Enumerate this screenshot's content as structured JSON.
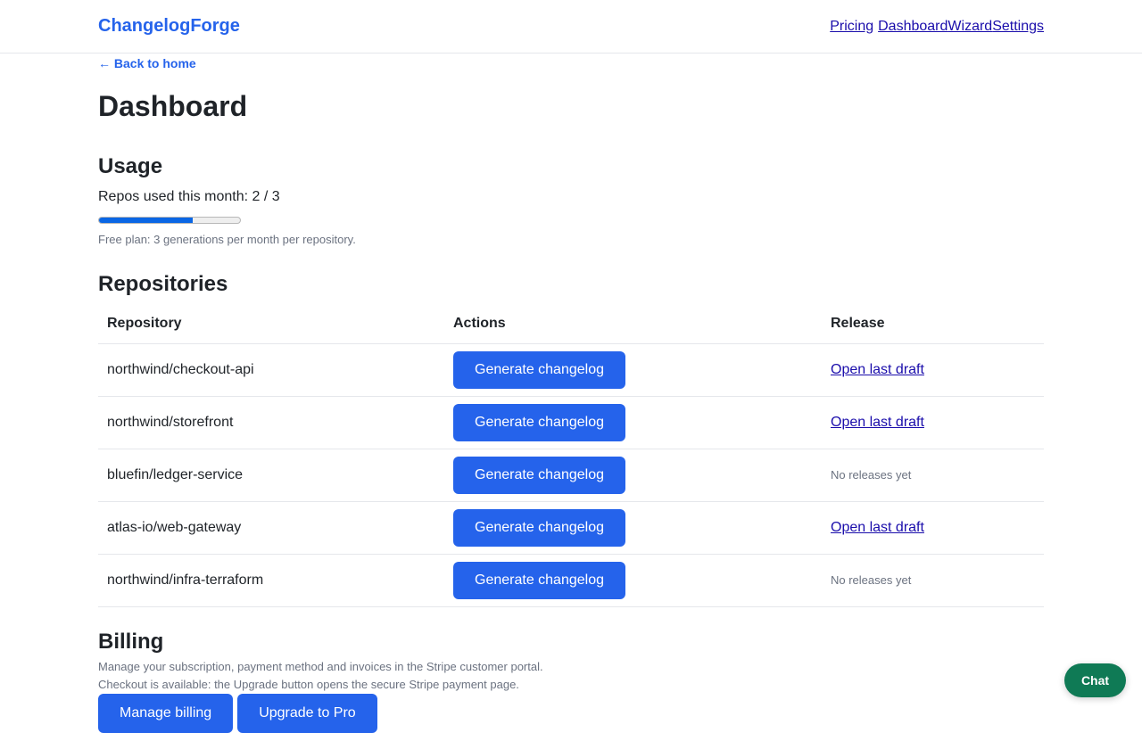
{
  "header": {
    "brand": "ChangelogForge",
    "nav": [
      "Pricing",
      "Dashboard",
      "Wizard",
      "Settings"
    ]
  },
  "back_link": "← Back to home",
  "page_title": "Dashboard",
  "usage": {
    "heading": "Usage",
    "text": "Repos used this month: 2 / 3",
    "progress_fraction": 0.6667,
    "note": "Free plan: 3 generations per month per repository."
  },
  "repositories": {
    "heading": "Repositories",
    "columns": [
      "Repository",
      "Actions",
      "Release"
    ],
    "rows": [
      {
        "repo": "northwind/checkout-api",
        "action": "Generate changelog",
        "release": "Open last draft",
        "has_release": true
      },
      {
        "repo": "northwind/storefront",
        "action": "Generate changelog",
        "release": "Open last draft",
        "has_release": true
      },
      {
        "repo": "bluefin/ledger-service",
        "action": "Generate changelog",
        "release": "No releases yet",
        "has_release": false
      },
      {
        "repo": "atlas-io/web-gateway",
        "action": "Generate changelog",
        "release": "Open last draft",
        "has_release": true
      },
      {
        "repo": "northwind/infra-terraform",
        "action": "Generate changelog",
        "release": "No releases yet",
        "has_release": false
      }
    ]
  },
  "billing": {
    "heading": "Billing",
    "line1": "Manage your subscription, payment method and invoices in the Stripe customer portal.",
    "line2": "Checkout is available: the Upgrade button opens the secure Stripe payment page.",
    "manage_label": "Manage billing",
    "upgrade_label": "Upgrade to Pro"
  },
  "chat_label": "Chat",
  "colors": {
    "accent": "#2563eb",
    "progress": "#0a66e4",
    "chat": "#0f7a55"
  }
}
